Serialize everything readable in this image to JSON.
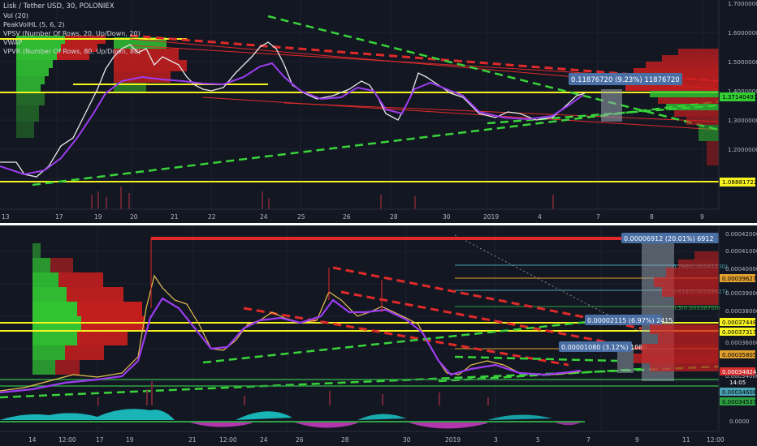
{
  "top_panel": {
    "title": "Lisk / Tether USD, 30, POLONIEX",
    "indicators": [
      "Vol (20)",
      "PeakVolHL (5, 6, 2)",
      "VPSV (Number Of Rows, 20, Up/Down, 20)",
      "VWAP",
      "VPVR (Number Of Rows, 80, Up/Down, 80)"
    ],
    "price_axis": [
      "1.70000000",
      "1.60000000",
      "1.50000000",
      "1.40000000",
      "1.30000000",
      "1.20000000",
      "1.10000000"
    ],
    "badges": {
      "last": "1.37140491",
      "low": "1.08881722"
    },
    "measure": "0.11876720 (9.23%) 11876720",
    "time_axis": [
      "13",
      "17",
      "19",
      "20",
      "21",
      "22",
      "24",
      "25",
      "26",
      "28",
      "30",
      "2019",
      "4",
      "7",
      "8",
      "9"
    ]
  },
  "bottom_panel": {
    "price_axis": [
      "0.00042000",
      "0.00041000",
      "0.00040000",
      "0.00039000",
      "0.00038000",
      "0.00037000",
      "0.00036000",
      "0.00035000",
      "0.00034000",
      "0.00033000"
    ],
    "osc_axis": "0.0000",
    "badges": [
      "0.00039627",
      "0.00037448",
      "0.00037317",
      "0.00035805",
      "0.00034824",
      "0.00034608",
      "0.00034537"
    ],
    "countdown": "14:05",
    "fib_labels": [
      "0.786(0.00041000)",
      "0.618(0.00039627)",
      "0.5(0.00038700)"
    ],
    "measures": [
      "0.00006912 (20.01%) 6912",
      "0.00002115 (6.97%) 2415",
      "0.00001080 (3.12%) 1080"
    ],
    "time_axis": [
      "14",
      "12:00",
      "17",
      "19",
      "21",
      "12:00",
      "24",
      "26",
      "28",
      "30",
      "2019",
      "3",
      "5",
      "7",
      "9",
      "11",
      "12:00"
    ]
  },
  "colors": {
    "background": "#131722",
    "grid": "#1f2535",
    "up": "#2ea043",
    "down": "#d32f2f",
    "vwap": "#9c3cf0",
    "yellow": "#f7f320",
    "green_dash": "#39d33a",
    "red_dash": "#e02a2a",
    "axis_text": "#b2b5be"
  }
}
